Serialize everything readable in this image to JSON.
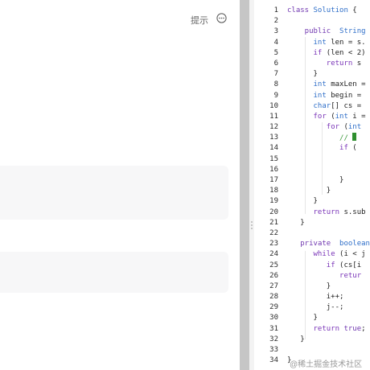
{
  "header": {
    "hint_label": "提示",
    "more_icon": "more-horizontal-icon"
  },
  "editor": {
    "line_numbers": [
      "1",
      "2",
      "3",
      "4",
      "5",
      "6",
      "7",
      "8",
      "9",
      "10",
      "11",
      "12",
      "13",
      "14",
      "15",
      "16",
      "17",
      "18",
      "19",
      "20",
      "21",
      "22",
      "23",
      "24",
      "25",
      "26",
      "27",
      "28",
      "29",
      "30",
      "31",
      "32",
      "33",
      "34"
    ],
    "lines": [
      [
        {
          "t": "class ",
          "c": "kw"
        },
        {
          "t": "Solution",
          "c": "ty"
        },
        {
          "t": " {"
        }
      ],
      [],
      [
        {
          "t": "    public  ",
          "c": "kw"
        },
        {
          "t": "String",
          "c": "ty"
        }
      ],
      [
        {
          "t": "      "
        },
        {
          "t": "int",
          "c": "ty"
        },
        {
          "t": " len = s."
        }
      ],
      [
        {
          "t": "      "
        },
        {
          "t": "if",
          "c": "ctrl"
        },
        {
          "t": " (len < 2)"
        }
      ],
      [
        {
          "t": "         "
        },
        {
          "t": "return",
          "c": "ctrl"
        },
        {
          "t": " s"
        }
      ],
      [
        {
          "t": "      }"
        }
      ],
      [
        {
          "t": "      "
        },
        {
          "t": "int",
          "c": "ty"
        },
        {
          "t": " maxLen ="
        }
      ],
      [
        {
          "t": "      "
        },
        {
          "t": "int",
          "c": "ty"
        },
        {
          "t": " begin ="
        }
      ],
      [
        {
          "t": "      "
        },
        {
          "t": "char",
          "c": "ty"
        },
        {
          "t": "[] cs ="
        }
      ],
      [
        {
          "t": "      "
        },
        {
          "t": "for",
          "c": "ctrl"
        },
        {
          "t": " ("
        },
        {
          "t": "int",
          "c": "ty"
        },
        {
          "t": " i ="
        }
      ],
      [
        {
          "t": "         "
        },
        {
          "t": "for",
          "c": "ctrl"
        },
        {
          "t": " ("
        },
        {
          "t": "int",
          "c": "ty"
        }
      ],
      [
        {
          "t": "            "
        },
        {
          "t": "// ",
          "c": "cm"
        },
        {
          "t": "|",
          "c": "cursor"
        }
      ],
      [
        {
          "t": "            "
        },
        {
          "t": "if",
          "c": "ctrl"
        },
        {
          "t": " ("
        }
      ],
      [],
      [],
      [
        {
          "t": "            }"
        }
      ],
      [
        {
          "t": "         }"
        }
      ],
      [
        {
          "t": "      }"
        }
      ],
      [
        {
          "t": "      "
        },
        {
          "t": "return",
          "c": "ctrl"
        },
        {
          "t": " s.sub"
        }
      ],
      [
        {
          "t": "   }"
        }
      ],
      [],
      [
        {
          "t": "   "
        },
        {
          "t": "private  ",
          "c": "kw"
        },
        {
          "t": "boolean",
          "c": "ty"
        }
      ],
      [
        {
          "t": "      "
        },
        {
          "t": "while",
          "c": "ctrl"
        },
        {
          "t": " (i < j"
        }
      ],
      [
        {
          "t": "         "
        },
        {
          "t": "if",
          "c": "ctrl"
        },
        {
          "t": " (cs[i"
        }
      ],
      [
        {
          "t": "            "
        },
        {
          "t": "retur",
          "c": "ctrl"
        }
      ],
      [
        {
          "t": "         }"
        }
      ],
      [
        {
          "t": "         i++;"
        }
      ],
      [
        {
          "t": "         j--;"
        }
      ],
      [
        {
          "t": "      }"
        }
      ],
      [
        {
          "t": "      "
        },
        {
          "t": "return",
          "c": "ctrl"
        },
        {
          "t": " "
        },
        {
          "t": "true",
          "c": "kw"
        },
        {
          "t": ";"
        }
      ],
      [
        {
          "t": "   }"
        }
      ],
      [],
      [
        {
          "t": "}"
        }
      ]
    ]
  },
  "watermark": "@稀土掘金技术社区"
}
